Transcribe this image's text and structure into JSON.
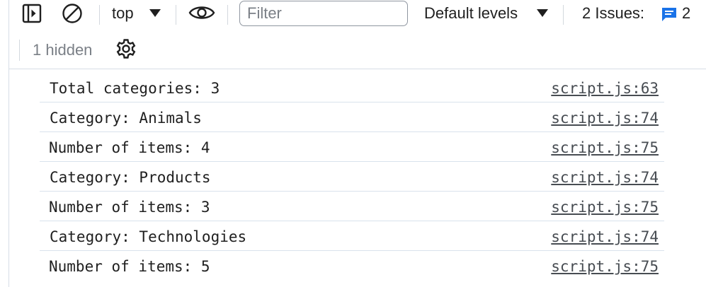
{
  "toolbar": {
    "context": "top",
    "filter_placeholder": "Filter",
    "levels": "Default levels",
    "issues_label": "2 Issues:",
    "issues_count": "2",
    "hidden": "1 hidden",
    "icons": [
      "sidebar-toggle-icon",
      "clear-console-icon",
      "eye-icon",
      "issues-icon",
      "settings-gear-icon"
    ],
    "accent_color": "#1a73e8"
  },
  "console": {
    "rows": [
      {
        "message": "Total categories: 3",
        "source": "script.js:63"
      },
      {
        "message": "Category: Animals",
        "source": "script.js:74"
      },
      {
        "message": "Number of items: 4",
        "source": "script.js:75"
      },
      {
        "message": "Category: Products",
        "source": "script.js:74"
      },
      {
        "message": "Number of items: 3",
        "source": "script.js:75"
      },
      {
        "message": "Category: Technologies",
        "source": "script.js:74"
      },
      {
        "message": "Number of items: 5",
        "source": "script.js:75"
      }
    ]
  }
}
